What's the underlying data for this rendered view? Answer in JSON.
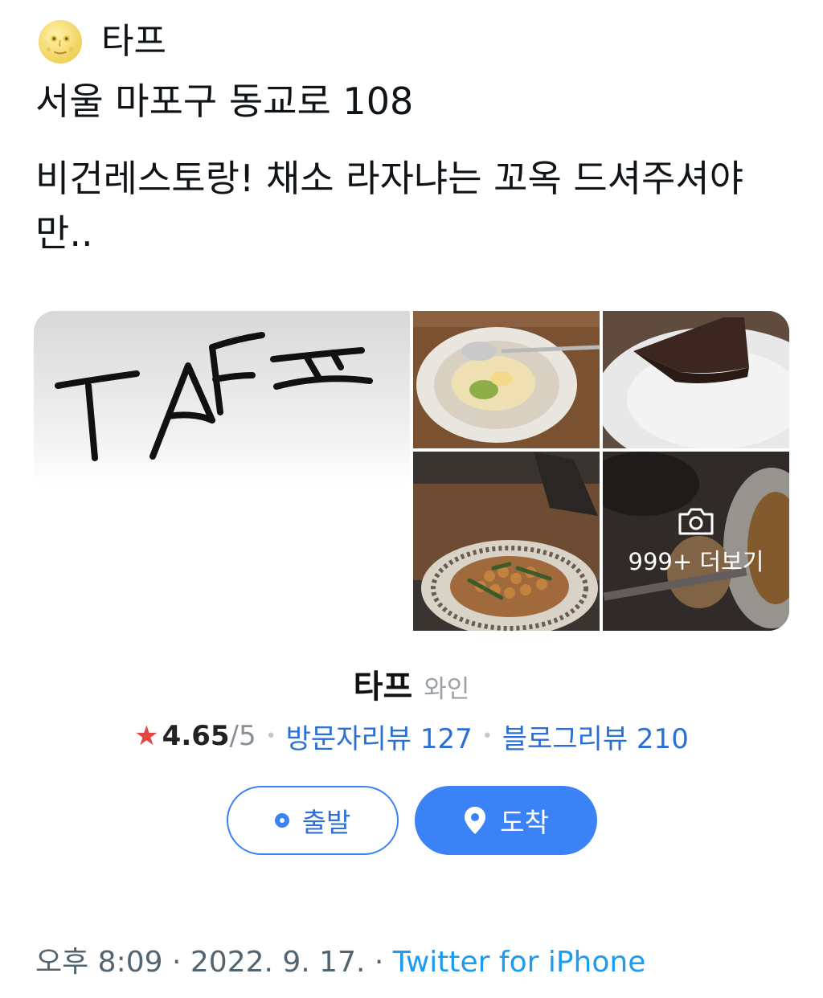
{
  "tweet": {
    "line1": "타프",
    "address": "서울 마포구 동교로 108",
    "body": "비건레스토랑! 채소 라자냐는 꼬옥 드셔주셔야만..",
    "emoji_icon": "full-moon-face-icon"
  },
  "card": {
    "logo_text": "TAFㅍ",
    "more_photos_label": "999+ 더보기",
    "place_name": "타프",
    "category": "와인",
    "rating": "4.65",
    "rating_max": "/5",
    "visitor_reviews": "방문자리뷰 127",
    "blog_reviews": "블로그리뷰 210",
    "depart_label": "출발",
    "arrive_label": "도착",
    "colors": {
      "accent": "#3b82f6",
      "star": "#e64545",
      "link": "#2a6fd6"
    }
  },
  "footer": {
    "time": "오후 8:09",
    "date": "2022. 9. 17.",
    "source": "Twitter for iPhone",
    "separator": "·"
  }
}
